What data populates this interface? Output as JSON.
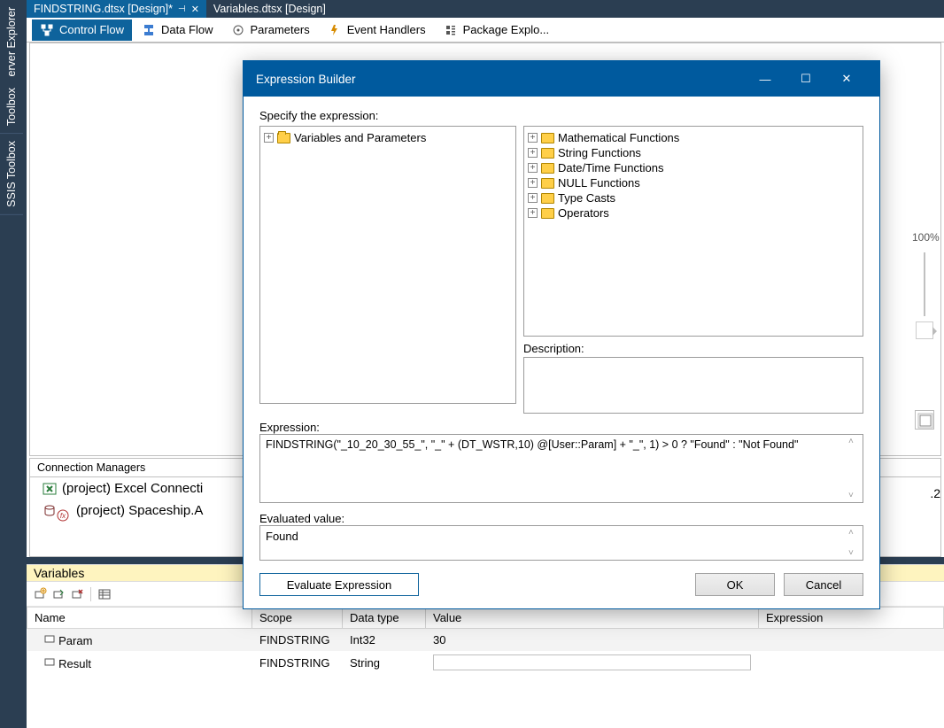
{
  "leftRail": {
    "tabs": [
      "erver Explorer",
      "Toolbox",
      "SSIS Toolbox"
    ]
  },
  "docTabs": {
    "active": {
      "label": "FINDSTRING.dtsx [Design]*"
    },
    "inactive": {
      "label": "Variables.dtsx [Design]"
    }
  },
  "designNav": {
    "controlFlow": "Control Flow",
    "dataFlow": "Data Flow",
    "parameters": "Parameters",
    "eventHandlers": "Event Handlers",
    "packageExplorer": "Package Explo..."
  },
  "rightTools": {
    "zoomPct": "100%"
  },
  "connMgr": {
    "header": "Connection Managers",
    "items": [
      "(project) Excel Connecti",
      "(project) Spaceship.A"
    ]
  },
  "variablesPanel": {
    "title": "Variables",
    "columns": {
      "name": "Name",
      "scope": "Scope",
      "dataType": "Data type",
      "value": "Value",
      "expression": "Expression"
    },
    "rows": [
      {
        "name": "Param",
        "scope": "FINDSTRING",
        "dataType": "Int32",
        "value": "30",
        "expression": ""
      },
      {
        "name": "Result",
        "scope": "FINDSTRING",
        "dataType": "String",
        "value": "",
        "expression": ""
      }
    ]
  },
  "dialog": {
    "title": "Expression Builder",
    "specifyLabel": "Specify the expression:",
    "leftTree": {
      "root": "Variables and Parameters"
    },
    "rightTree": {
      "nodes": [
        "Mathematical Functions",
        "String Functions",
        "Date/Time Functions",
        "NULL Functions",
        "Type Casts",
        "Operators"
      ]
    },
    "descriptionLabel": "Description:",
    "expressionLabel": "Expression:",
    "expressionText": "FINDSTRING(\"_10_20_30_55_\", \"_\" + (DT_WSTR,10) @[User::Param] + \"_\", 1) > 0 ? \"Found\" : \"Not Found\"",
    "evaluatedLabel": "Evaluated value:",
    "evaluatedValue": "Found",
    "buttons": {
      "evaluate": "Evaluate Expression",
      "ok": "OK",
      "cancel": "Cancel"
    }
  },
  "misc": {
    "truncatedNumber": ".2"
  }
}
